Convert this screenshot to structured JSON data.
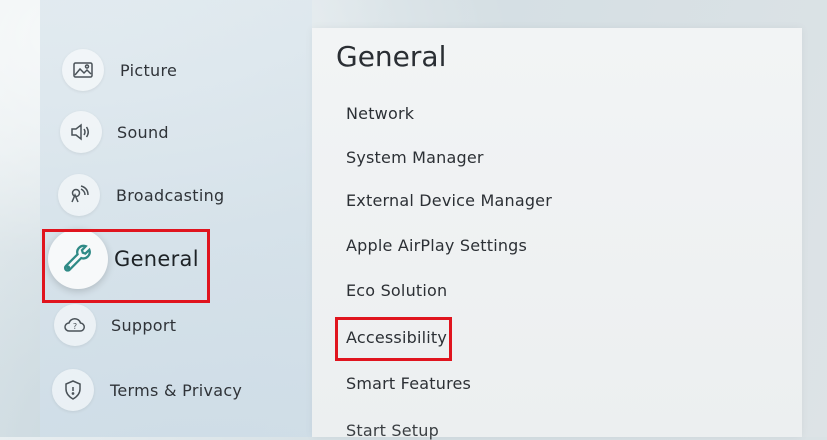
{
  "left_menu": {
    "items": [
      {
        "label": "Picture",
        "icon": "picture-icon"
      },
      {
        "label": "Sound",
        "icon": "speaker-icon"
      },
      {
        "label": "Broadcasting",
        "icon": "broadcast-icon"
      },
      {
        "label": "General",
        "icon": "wrench-icon",
        "selected": true
      },
      {
        "label": "Support",
        "icon": "support-cloud-icon"
      },
      {
        "label": "Terms & Privacy",
        "icon": "shield-icon"
      }
    ]
  },
  "general_panel": {
    "title": "General",
    "items": [
      {
        "label": "Network"
      },
      {
        "label": "System Manager"
      },
      {
        "label": "External Device Manager"
      },
      {
        "label": "Apple AirPlay Settings"
      },
      {
        "label": "Eco Solution"
      },
      {
        "label": "Accessibility",
        "highlighted": true
      },
      {
        "label": "Smart Features"
      },
      {
        "label": "Start Setup"
      }
    ]
  },
  "colors": {
    "highlight": "#e0141e",
    "panel_bg": "#f2f4f5",
    "menu_bg": "#d8e3ea",
    "icon_stroke": "#4a5258",
    "selected_icon": "#2f8a86"
  }
}
